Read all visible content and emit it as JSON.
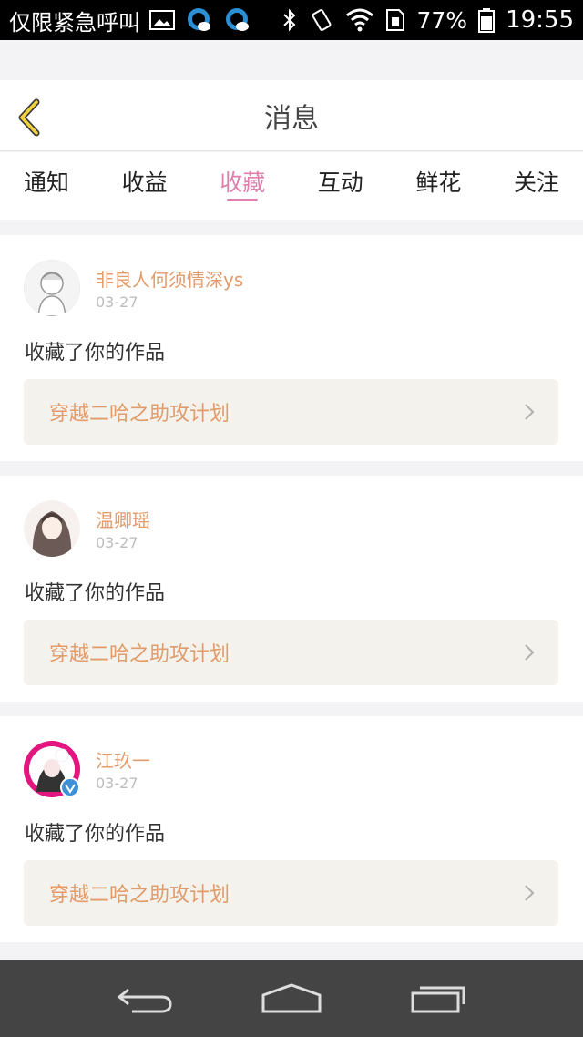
{
  "status_bar": {
    "carrier_text": "仅限紧急呼叫",
    "battery_percent": "77%",
    "time": "19:55",
    "icons": [
      "image-icon",
      "qq-icon",
      "qq-icon",
      "bluetooth-icon",
      "vibrate-icon",
      "wifi-icon",
      "sim-icon",
      "battery-icon"
    ]
  },
  "header": {
    "title": "消息",
    "back_icon": "chevron-left-icon"
  },
  "tabs": [
    {
      "label": "通知",
      "active": false
    },
    {
      "label": "收益",
      "active": false
    },
    {
      "label": "收藏",
      "active": true
    },
    {
      "label": "互动",
      "active": false
    },
    {
      "label": "鲜花",
      "active": false
    },
    {
      "label": "关注",
      "active": false
    }
  ],
  "messages": [
    {
      "username": "非良人何须情深ys",
      "date": "03-27",
      "action": "收藏了你的作品",
      "work_title": "穿越二哈之助攻计划"
    },
    {
      "username": "温卿瑶",
      "date": "03-27",
      "action": "收藏了你的作品",
      "work_title": "穿越二哈之助攻计划"
    },
    {
      "username": "江玖一",
      "date": "03-27",
      "action": "收藏了你的作品",
      "work_title": "穿越二哈之助攻计划",
      "verified": true
    }
  ],
  "colors": {
    "accent": "#e07fae",
    "username": "#e29b6a",
    "work_bg": "#f4f2ec"
  },
  "navbar": {
    "icons": [
      "back-icon",
      "home-icon",
      "recent-apps-icon"
    ]
  }
}
